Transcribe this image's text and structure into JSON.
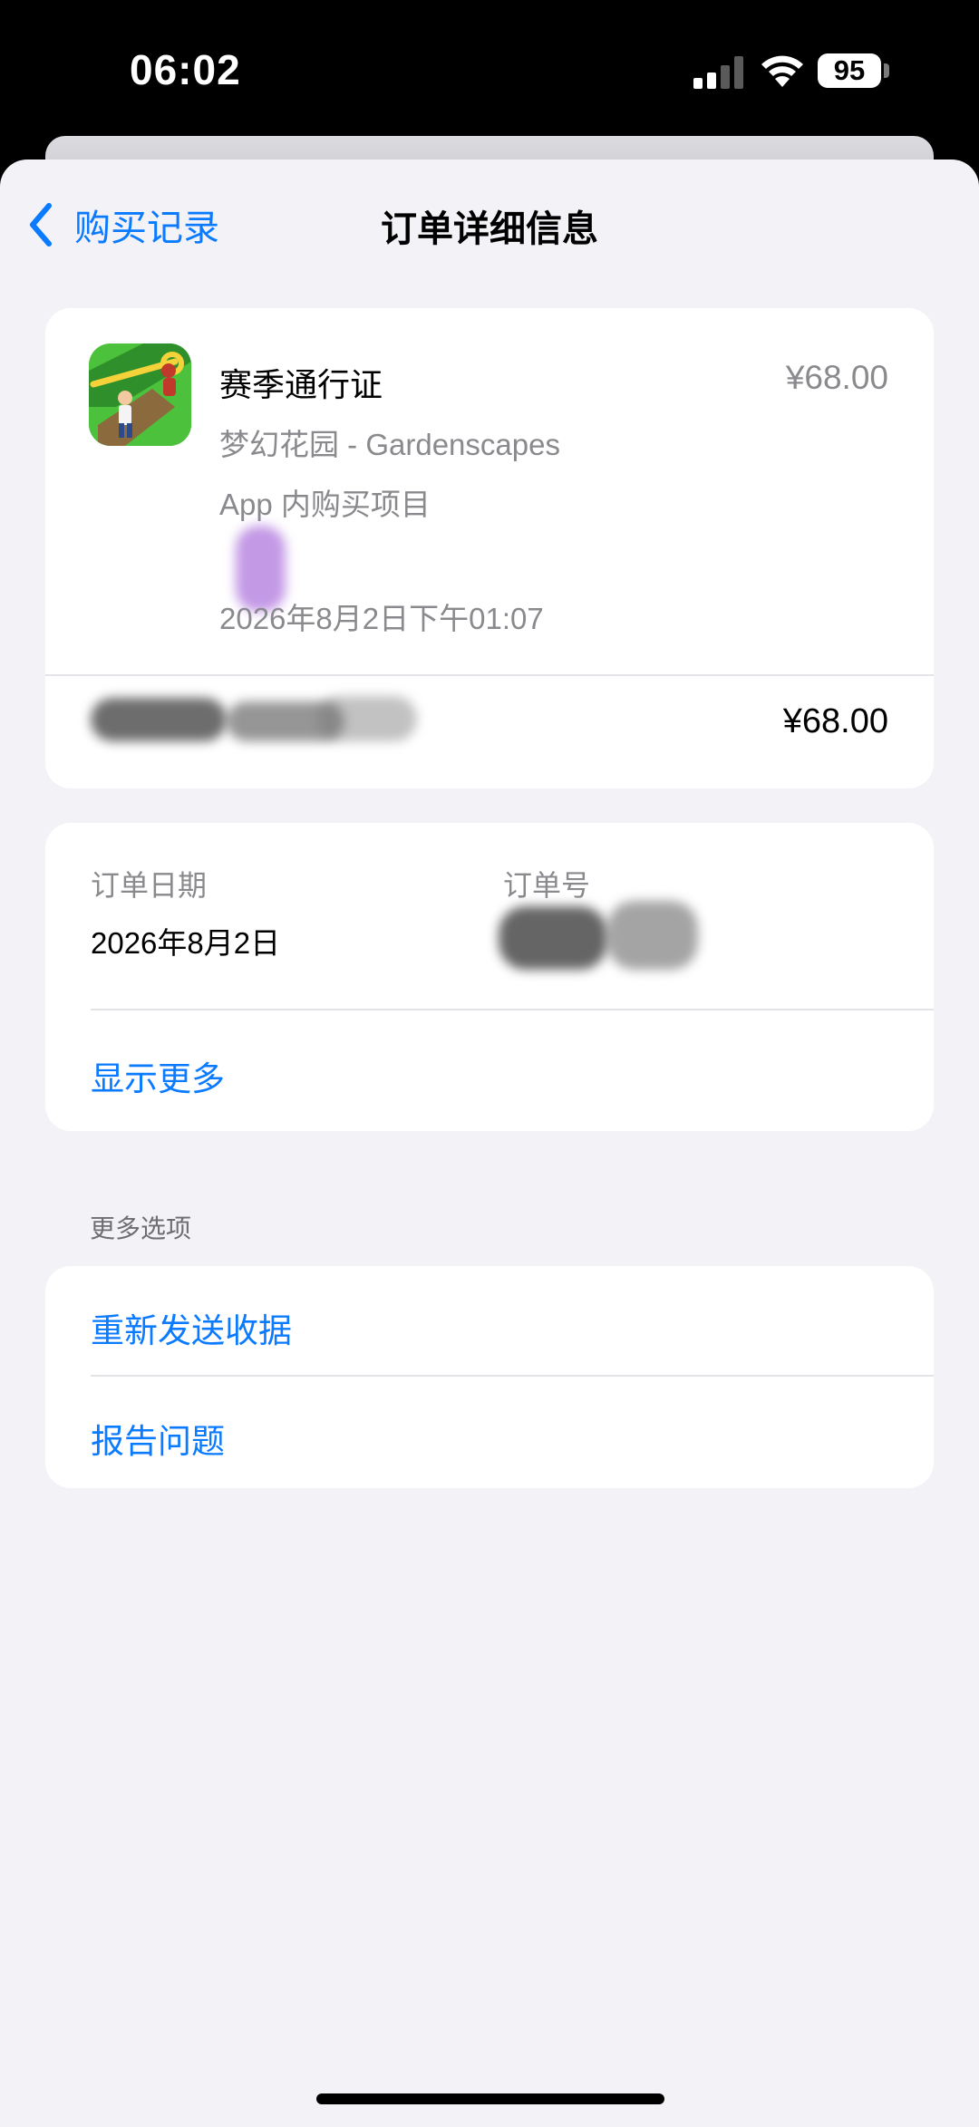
{
  "status_bar": {
    "time": "06:02",
    "battery": "95",
    "icons": [
      "cellular-signal-icon",
      "wifi-icon",
      "battery-icon"
    ]
  },
  "nav": {
    "back_label": "购买记录",
    "title": "订单详细信息"
  },
  "purchase": {
    "app_icon": "gardenscapes-app-icon",
    "item_name": "赛季通行证",
    "price": "¥68.00",
    "app_name": "梦幻花园 - Gardenscapes",
    "item_type": "App 内购买项目",
    "date": "2026年8月2日下午01:07",
    "total": "¥68.00"
  },
  "order_info": {
    "date_label": "订单日期",
    "date_value": "2026年8月2日",
    "number_label": "订单号",
    "show_more": "显示更多"
  },
  "more_options": {
    "header": "更多选项",
    "resend_receipt": "重新发送收据",
    "report_problem": "报告问题"
  },
  "colors": {
    "accent": "#0a7aff",
    "background": "#f2f2f7",
    "secondary_text": "#8a8a8e"
  }
}
